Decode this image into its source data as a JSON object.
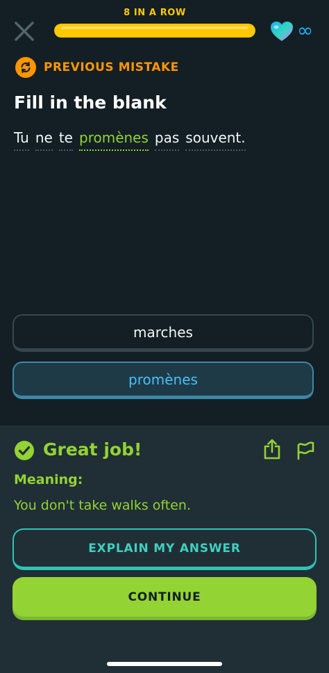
{
  "header": {
    "streak_label": "8 IN A ROW",
    "progress_fraction": 1.0,
    "hearts": "∞"
  },
  "badge": {
    "label": "PREVIOUS MISTAKE"
  },
  "prompt": {
    "title": "Fill in the blank",
    "words": [
      "Tu",
      "ne",
      "te",
      "promènes",
      "pas",
      "souvent."
    ]
  },
  "options": [
    {
      "label": "marches"
    },
    {
      "label": "promènes",
      "selected": true
    }
  ],
  "feedback": {
    "title": "Great job!",
    "meaning_label": "Meaning:",
    "meaning_text": "You don't take walks often.",
    "explain_label": "EXPLAIN MY ANSWER",
    "continue_label": "CONTINUE"
  },
  "colors": {
    "background": "#131f24",
    "streak": "#ffc800",
    "badge": "#ff9600",
    "correct": "#93d333",
    "selected": "#49c0f8",
    "explain": "#2ec4b6"
  },
  "icons": {
    "close": "close-icon",
    "heart": "heart-icon",
    "infinity": "infinity-icon",
    "badge": "refresh-icon",
    "check": "check-circle-icon",
    "share": "share-icon",
    "flag": "flag-icon"
  }
}
